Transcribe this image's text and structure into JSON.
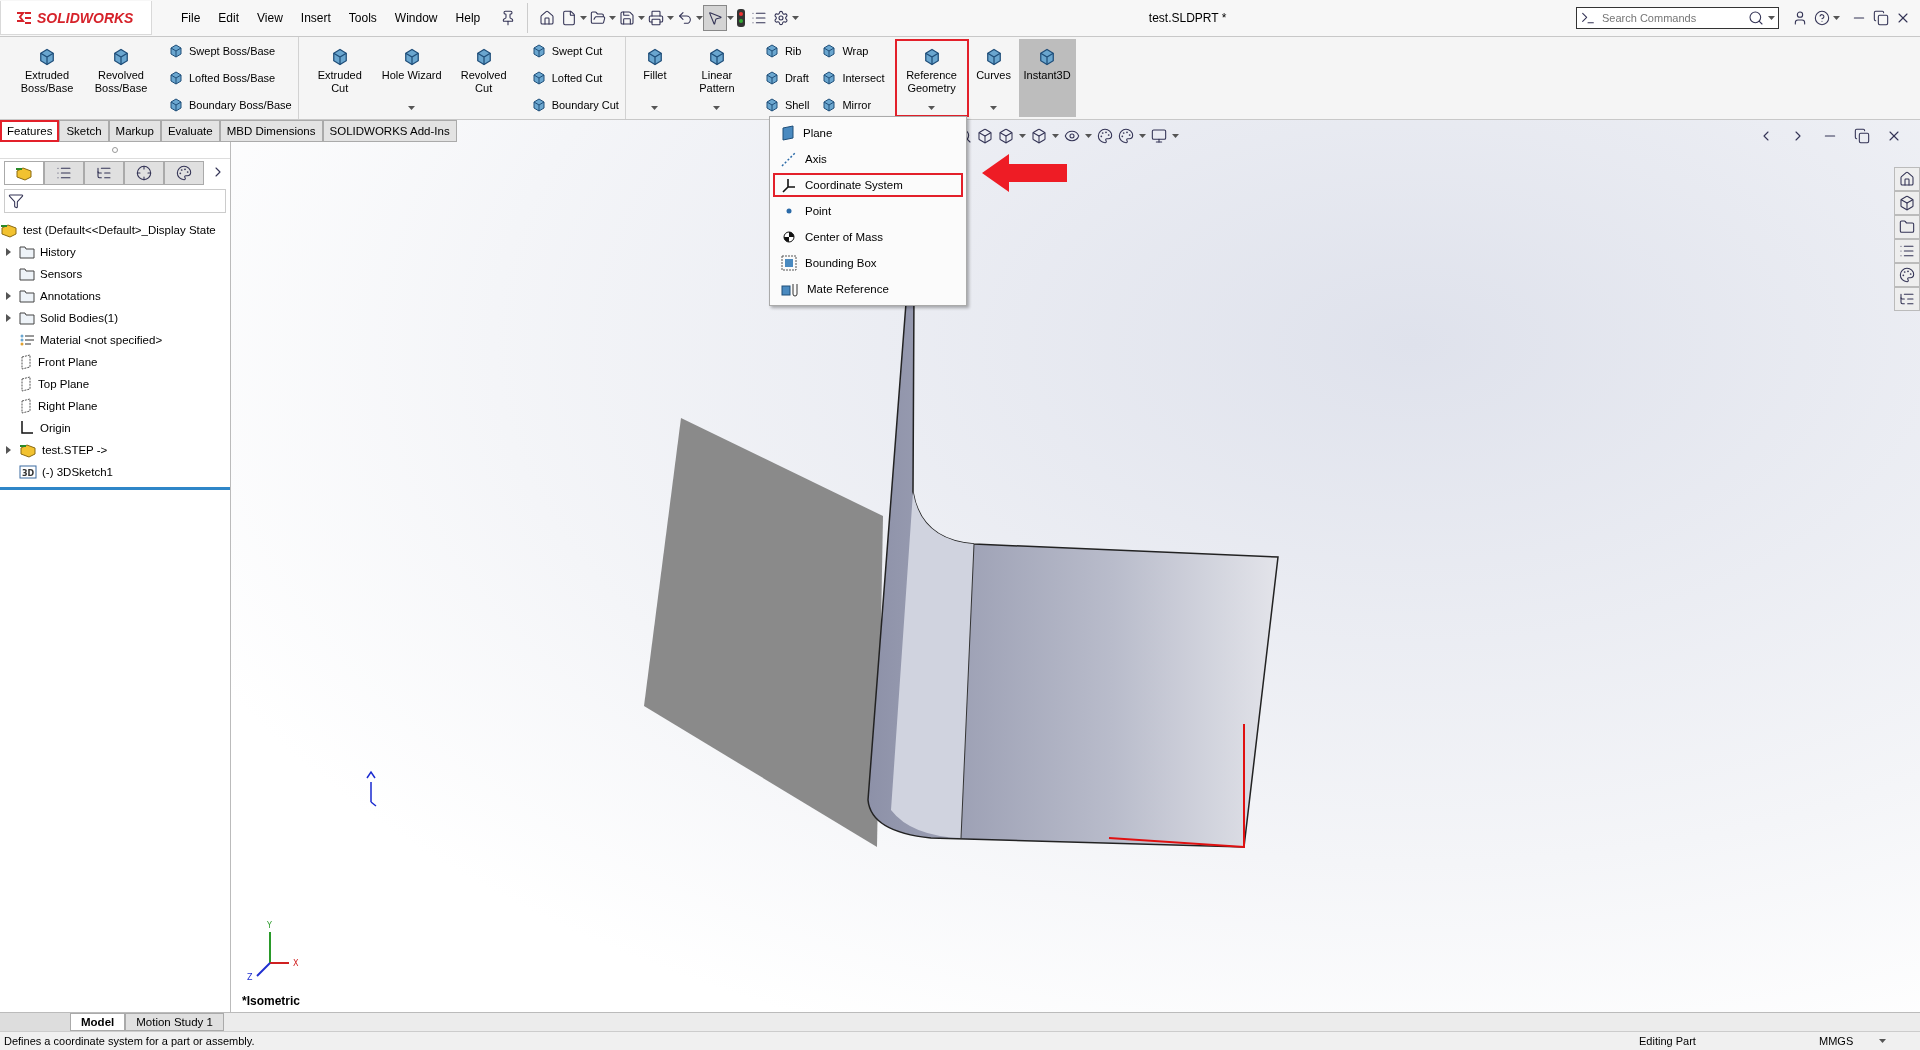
{
  "app": {
    "logo": "SOLIDWORKS",
    "menu": [
      "File",
      "Edit",
      "View",
      "Insert",
      "Tools",
      "Window",
      "Help"
    ],
    "title": "test.SLDPRT *",
    "search": {
      "placeholder": "Search Commands"
    }
  },
  "ribbon": {
    "groups": [
      {
        "kind": "large",
        "items": [
          {
            "label": "Extruded Boss/Base",
            "dropdown": false,
            "highlighted": false,
            "pressed": false
          },
          {
            "label": "Revolved Boss/Base",
            "dropdown": false,
            "highlighted": false,
            "pressed": false
          }
        ]
      },
      {
        "kind": "stack",
        "items": [
          {
            "label": "Swept Boss/Base"
          },
          {
            "label": "Lofted Boss/Base"
          },
          {
            "label": "Boundary Boss/Base"
          }
        ]
      },
      {
        "kind": "large",
        "separator": true,
        "items": [
          {
            "label": "Extruded Cut",
            "dropdown": false,
            "highlighted": false,
            "pressed": false
          },
          {
            "label": "Hole Wizard",
            "dropdown": true,
            "highlighted": false,
            "pressed": false
          },
          {
            "label": "Revolved Cut",
            "dropdown": false,
            "highlighted": false,
            "pressed": false
          }
        ]
      },
      {
        "kind": "stack",
        "items": [
          {
            "label": "Swept Cut"
          },
          {
            "label": "Lofted Cut"
          },
          {
            "label": "Boundary Cut"
          }
        ]
      },
      {
        "kind": "large",
        "separator": true,
        "items": [
          {
            "label": "Fillet",
            "dropdown": true,
            "highlighted": false,
            "pressed": false
          },
          {
            "label": "Linear Pattern",
            "dropdown": true,
            "highlighted": false,
            "pressed": false
          }
        ]
      },
      {
        "kind": "stack",
        "items": [
          {
            "label": "Rib"
          },
          {
            "label": "Draft"
          },
          {
            "label": "Shell"
          }
        ]
      },
      {
        "kind": "stack",
        "items": [
          {
            "label": "Wrap"
          },
          {
            "label": "Intersect"
          },
          {
            "label": "Mirror"
          }
        ]
      },
      {
        "kind": "large",
        "items": [
          {
            "label": "Reference Geometry",
            "dropdown": true,
            "highlighted": true,
            "pressed": false
          },
          {
            "label": "Curves",
            "dropdown": true,
            "highlighted": false,
            "pressed": false
          },
          {
            "label": "Instant3D",
            "dropdown": false,
            "highlighted": false,
            "pressed": true
          }
        ]
      }
    ]
  },
  "tabs": [
    {
      "label": "Features",
      "selected": true,
      "highlighted": true
    },
    {
      "label": "Sketch",
      "selected": false,
      "highlighted": false
    },
    {
      "label": "Markup",
      "selected": false,
      "highlighted": false
    },
    {
      "label": "Evaluate",
      "selected": false,
      "highlighted": false
    },
    {
      "label": "MBD Dimensions",
      "selected": false,
      "highlighted": false
    },
    {
      "label": "SOLIDWORKS Add-Ins",
      "selected": false,
      "highlighted": false
    }
  ],
  "feature_tree": {
    "root": "test  (Default<<Default>_Display State",
    "children": [
      {
        "label": "History",
        "kind": "folder",
        "expandable": true
      },
      {
        "label": "Sensors",
        "kind": "folder",
        "expandable": false
      },
      {
        "label": "Annotations",
        "kind": "folder",
        "expandable": true
      },
      {
        "label": "Solid Bodies(1)",
        "kind": "folder",
        "expandable": true
      },
      {
        "label": "Material <not specified>",
        "kind": "material",
        "expandable": false
      },
      {
        "label": "Front Plane",
        "kind": "plane",
        "expandable": false
      },
      {
        "label": "Top Plane",
        "kind": "plane",
        "expandable": false
      },
      {
        "label": "Right Plane",
        "kind": "plane",
        "expandable": false
      },
      {
        "label": "Origin",
        "kind": "origin",
        "expandable": false
      },
      {
        "label": "test.STEP ->",
        "kind": "part",
        "expandable": true
      },
      {
        "label": "(-) 3DSketch1",
        "kind": "sketch",
        "expandable": false,
        "badge": "3D"
      }
    ]
  },
  "panel_tabs": [
    {
      "selected": true
    },
    {
      "selected": false
    },
    {
      "selected": false
    },
    {
      "selected": false
    },
    {
      "selected": false
    }
  ],
  "reference_menu": [
    {
      "label": "Plane",
      "kind": "plane",
      "selected": false
    },
    {
      "label": "Axis",
      "kind": "axis",
      "selected": false
    },
    {
      "label": "Coordinate System",
      "kind": "coordinate",
      "selected": true
    },
    {
      "label": "Point",
      "kind": "point",
      "selected": false
    },
    {
      "label": "Center of Mass",
      "kind": "mass",
      "selected": false
    },
    {
      "label": "Bounding Box",
      "kind": "box",
      "selected": false
    },
    {
      "label": "Mate Reference",
      "kind": "mate",
      "selected": false
    }
  ],
  "graphics": {
    "view_name": "*Isometric",
    "triad_labels": {
      "y": "Y",
      "x": "X",
      "z": "Z"
    }
  },
  "bottom_tabs": [
    {
      "label": "Model",
      "selected": true
    },
    {
      "label": "Motion Study 1",
      "selected": false
    }
  ],
  "status_bar": {
    "message": "Defines a coordinate system for a part or assembly.",
    "mode": "Editing Part",
    "units": "MMGS"
  }
}
